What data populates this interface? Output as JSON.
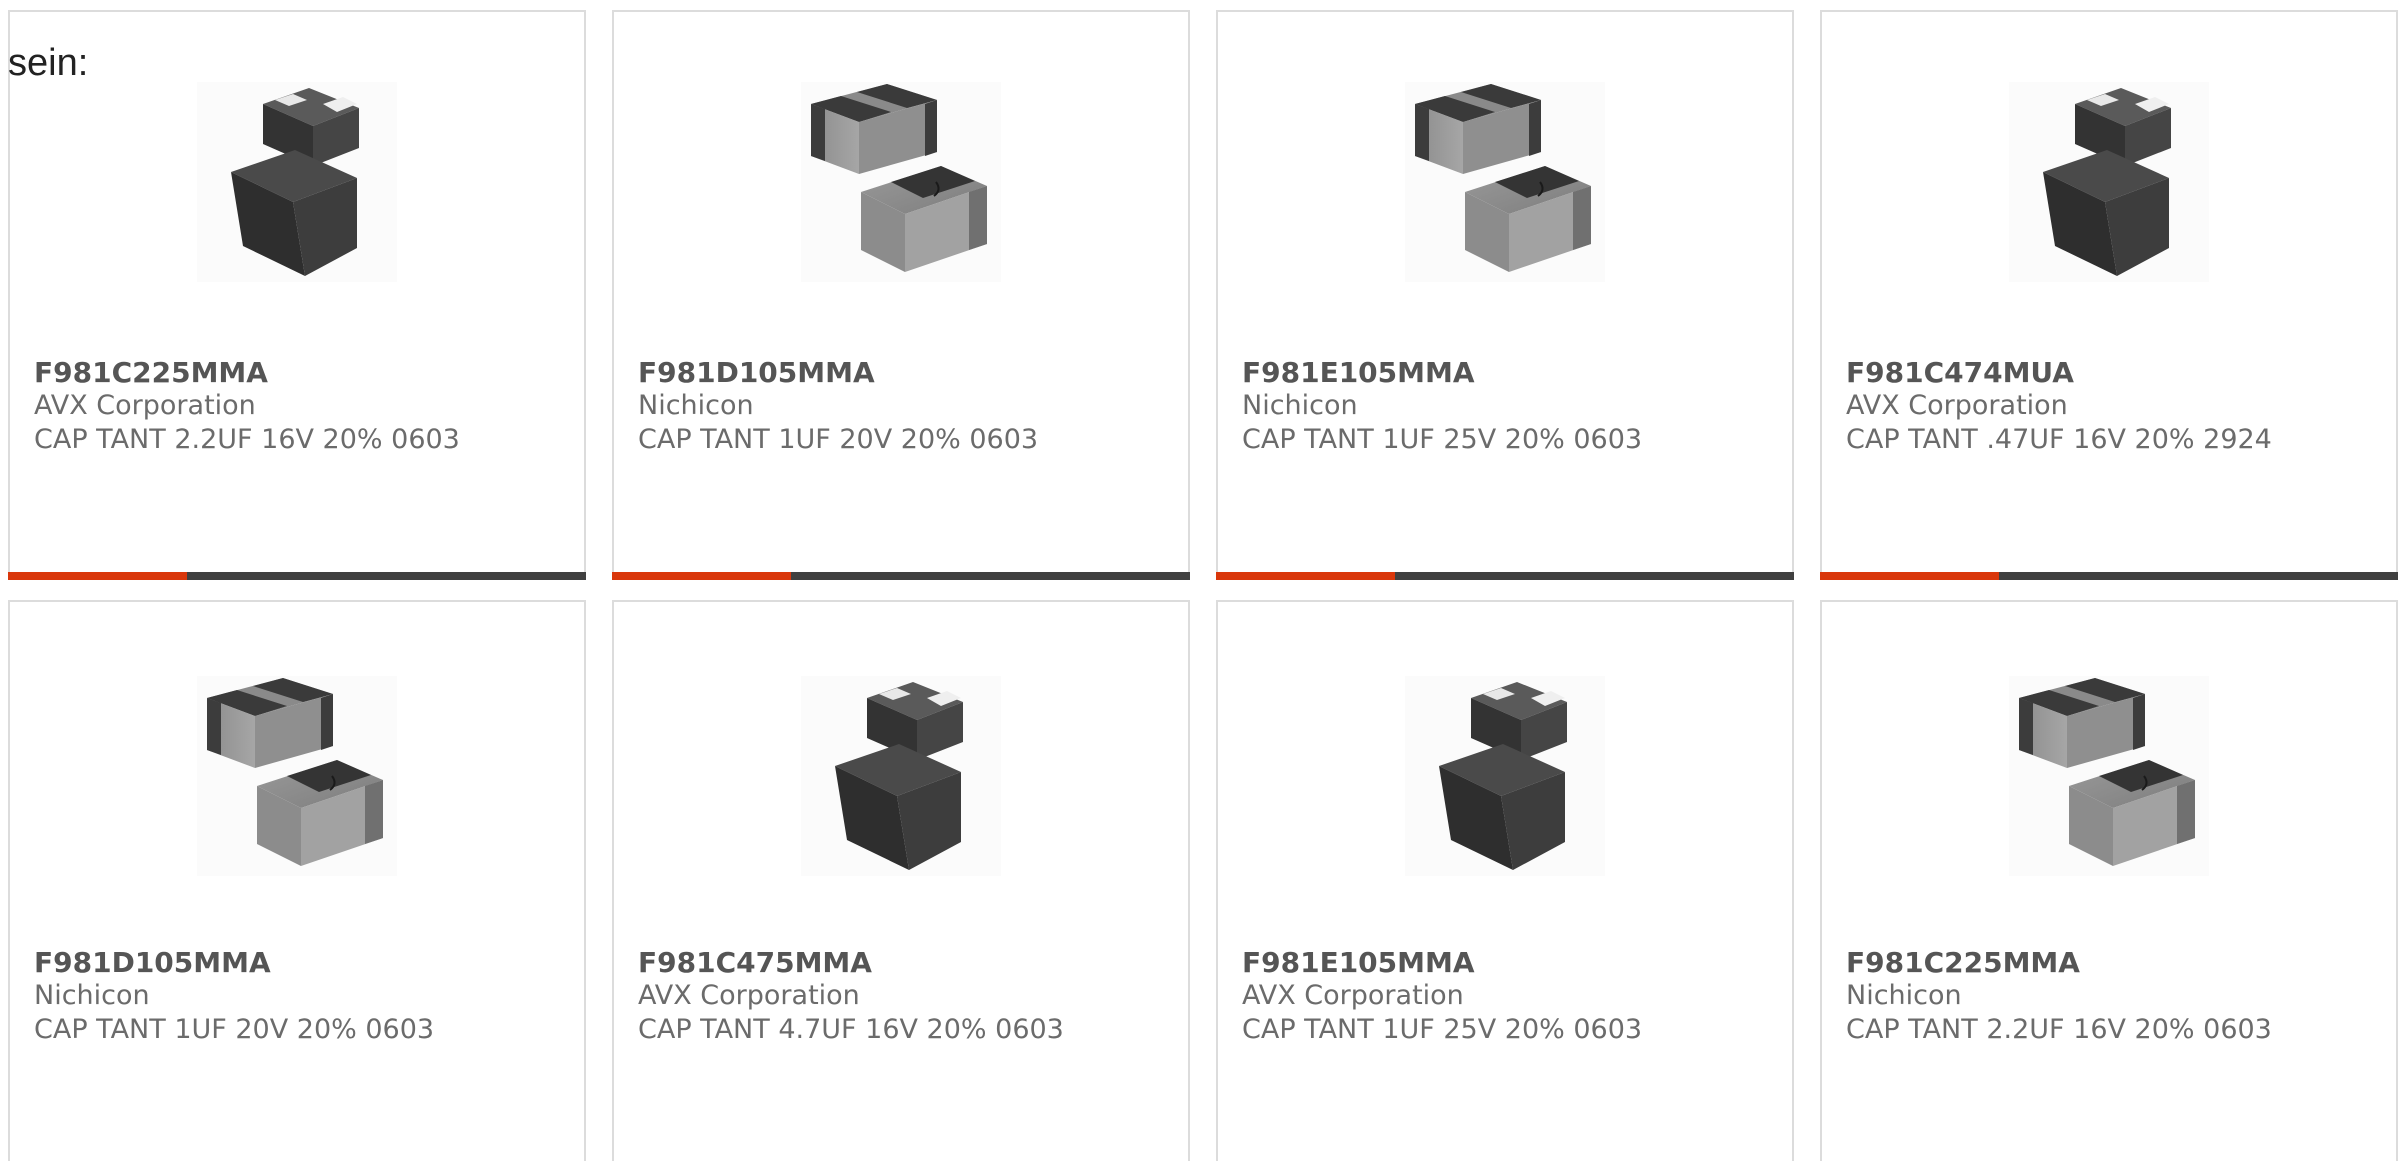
{
  "intro_text": "sein:",
  "colors": {
    "accent": "#d9370b",
    "bar_track": "#404040",
    "border": "#dcdcdc",
    "text": "#6b6b6b"
  },
  "products": [
    {
      "part": "F981C225MMA",
      "manufacturer": "AVX Corporation",
      "description": "CAP TANT 2.2UF 16V 20% 0603",
      "image": "dark-capacitor-image",
      "progress": 0.31
    },
    {
      "part": "F981D105MMA",
      "manufacturer": "Nichicon",
      "description": "CAP TANT 1UF 20V 20% 0603",
      "image": "gray-capacitor-image",
      "progress": 0.31
    },
    {
      "part": "F981E105MMA",
      "manufacturer": "Nichicon",
      "description": "CAP TANT 1UF 25V 20% 0603",
      "image": "gray-capacitor-image",
      "progress": 0.31
    },
    {
      "part": "F981C474MUA",
      "manufacturer": "AVX Corporation",
      "description": "CAP TANT .47UF 16V 20% 2924",
      "image": "dark-capacitor-image",
      "progress": 0.31
    },
    {
      "part": "F981D105MMA",
      "manufacturer": "Nichicon",
      "description": "CAP TANT 1UF 20V 20% 0603",
      "image": "gray-capacitor-image"
    },
    {
      "part": "F981C475MMA",
      "manufacturer": "AVX Corporation",
      "description": "CAP TANT 4.7UF 16V 20% 0603",
      "image": "dark-capacitor-image"
    },
    {
      "part": "F981E105MMA",
      "manufacturer": "AVX Corporation",
      "description": "CAP TANT 1UF 25V 20% 0603",
      "image": "dark-capacitor-image"
    },
    {
      "part": "F981C225MMA",
      "manufacturer": "Nichicon",
      "description": "CAP TANT 2.2UF 16V 20% 0603",
      "image": "gray-capacitor-image"
    }
  ]
}
